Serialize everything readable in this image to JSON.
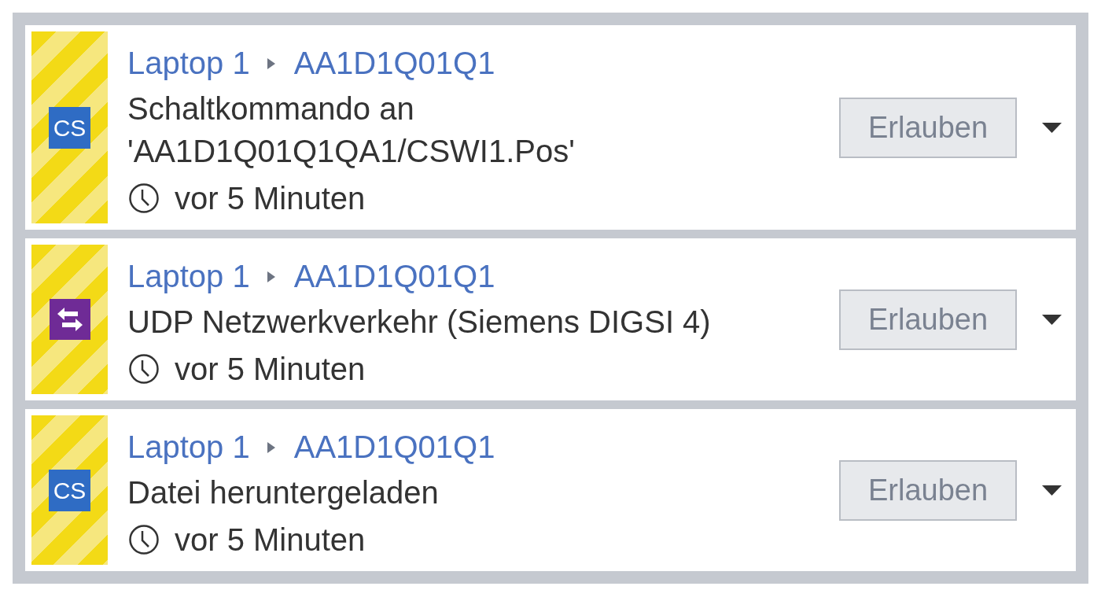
{
  "notifications": [
    {
      "source": "Laptop 1",
      "target": "AA1D1Q01Q1",
      "icon": {
        "kind": "label",
        "text": "CS"
      },
      "message": "Schaltkommando an 'AA1D1Q01Q1QA1/CSWI1.Pos'",
      "time": "vor 5 Minuten",
      "action": "Erlauben"
    },
    {
      "source": "Laptop 1",
      "target": "AA1D1Q01Q1",
      "icon": {
        "kind": "swap"
      },
      "message": "UDP Netzwerkverkehr (Siemens DIGSI 4)",
      "time": "vor 5 Minuten",
      "action": "Erlauben"
    },
    {
      "source": "Laptop 1",
      "target": "AA1D1Q01Q1",
      "icon": {
        "kind": "label",
        "text": "CS"
      },
      "message": "Datei heruntergeladen",
      "time": "vor 5 Minuten",
      "action": "Erlauben"
    }
  ]
}
